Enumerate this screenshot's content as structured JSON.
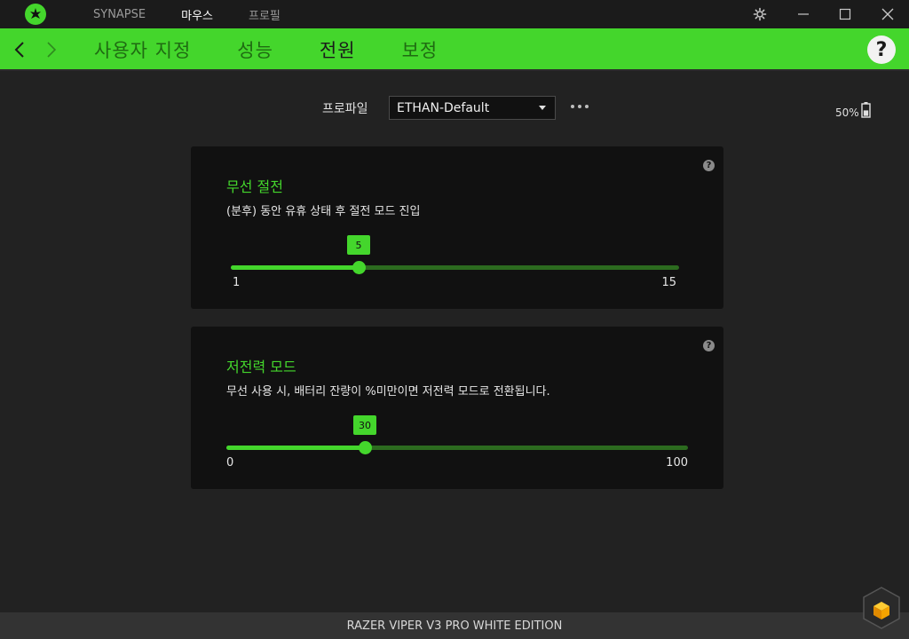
{
  "titlebar": {
    "nav": [
      "SYNAPSE",
      "마우스",
      "프로필"
    ],
    "active_index": 1
  },
  "header": {
    "tabs": [
      "사용자 지정",
      "성능",
      "전원",
      "보정"
    ],
    "active_tab": "전원",
    "help_label": "?"
  },
  "profile": {
    "label": "프로파일",
    "selected": "ETHAN-Default"
  },
  "battery": {
    "text": "50%",
    "level_percent": 50
  },
  "cards": {
    "wireless_sleep": {
      "title": "무선 절전",
      "description": "(분후) 동안 유휴 상태 후 절전 모드 진입",
      "value": "5",
      "min": "1",
      "max": "15",
      "value_num": 5,
      "min_num": 1,
      "max_num": 15
    },
    "low_power": {
      "title": "저전력 모드",
      "description": "무선 사용 시, 배터리 잔량이 %미만이면 저전력 모드로 전환됩니다.",
      "value": "30",
      "min": "0",
      "max": "100",
      "value_num": 30,
      "min_num": 0,
      "max_num": 100
    }
  },
  "footer": {
    "device_name": "RAZER VIPER V3 PRO WHITE EDITION"
  },
  "colors": {
    "accent": "#44d62c",
    "track": "#2c6b1f",
    "card_bg": "#111111",
    "app_bg": "#222222"
  },
  "icons": {
    "logo": "razer-logo-icon",
    "settings": "gear-icon",
    "minimize": "minimize-icon",
    "maximize": "maximize-icon",
    "close": "close-icon",
    "back": "chevron-left-icon",
    "forward": "chevron-right-icon",
    "more": "more-dots-icon",
    "battery": "battery-icon",
    "cube": "synapse-cube-icon"
  }
}
